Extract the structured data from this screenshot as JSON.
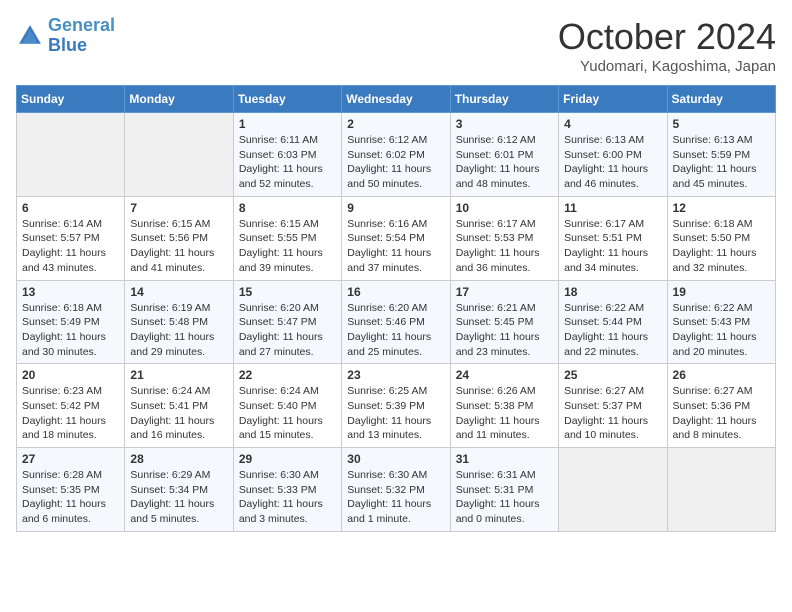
{
  "header": {
    "logo_line1": "General",
    "logo_line2": "Blue",
    "month": "October 2024",
    "location": "Yudomari, Kagoshima, Japan"
  },
  "columns": [
    "Sunday",
    "Monday",
    "Tuesday",
    "Wednesday",
    "Thursday",
    "Friday",
    "Saturday"
  ],
  "weeks": [
    [
      {
        "day": "",
        "info": ""
      },
      {
        "day": "",
        "info": ""
      },
      {
        "day": "1",
        "info": "Sunrise: 6:11 AM\nSunset: 6:03 PM\nDaylight: 11 hours and 52 minutes."
      },
      {
        "day": "2",
        "info": "Sunrise: 6:12 AM\nSunset: 6:02 PM\nDaylight: 11 hours and 50 minutes."
      },
      {
        "day": "3",
        "info": "Sunrise: 6:12 AM\nSunset: 6:01 PM\nDaylight: 11 hours and 48 minutes."
      },
      {
        "day": "4",
        "info": "Sunrise: 6:13 AM\nSunset: 6:00 PM\nDaylight: 11 hours and 46 minutes."
      },
      {
        "day": "5",
        "info": "Sunrise: 6:13 AM\nSunset: 5:59 PM\nDaylight: 11 hours and 45 minutes."
      }
    ],
    [
      {
        "day": "6",
        "info": "Sunrise: 6:14 AM\nSunset: 5:57 PM\nDaylight: 11 hours and 43 minutes."
      },
      {
        "day": "7",
        "info": "Sunrise: 6:15 AM\nSunset: 5:56 PM\nDaylight: 11 hours and 41 minutes."
      },
      {
        "day": "8",
        "info": "Sunrise: 6:15 AM\nSunset: 5:55 PM\nDaylight: 11 hours and 39 minutes."
      },
      {
        "day": "9",
        "info": "Sunrise: 6:16 AM\nSunset: 5:54 PM\nDaylight: 11 hours and 37 minutes."
      },
      {
        "day": "10",
        "info": "Sunrise: 6:17 AM\nSunset: 5:53 PM\nDaylight: 11 hours and 36 minutes."
      },
      {
        "day": "11",
        "info": "Sunrise: 6:17 AM\nSunset: 5:51 PM\nDaylight: 11 hours and 34 minutes."
      },
      {
        "day": "12",
        "info": "Sunrise: 6:18 AM\nSunset: 5:50 PM\nDaylight: 11 hours and 32 minutes."
      }
    ],
    [
      {
        "day": "13",
        "info": "Sunrise: 6:18 AM\nSunset: 5:49 PM\nDaylight: 11 hours and 30 minutes."
      },
      {
        "day": "14",
        "info": "Sunrise: 6:19 AM\nSunset: 5:48 PM\nDaylight: 11 hours and 29 minutes."
      },
      {
        "day": "15",
        "info": "Sunrise: 6:20 AM\nSunset: 5:47 PM\nDaylight: 11 hours and 27 minutes."
      },
      {
        "day": "16",
        "info": "Sunrise: 6:20 AM\nSunset: 5:46 PM\nDaylight: 11 hours and 25 minutes."
      },
      {
        "day": "17",
        "info": "Sunrise: 6:21 AM\nSunset: 5:45 PM\nDaylight: 11 hours and 23 minutes."
      },
      {
        "day": "18",
        "info": "Sunrise: 6:22 AM\nSunset: 5:44 PM\nDaylight: 11 hours and 22 minutes."
      },
      {
        "day": "19",
        "info": "Sunrise: 6:22 AM\nSunset: 5:43 PM\nDaylight: 11 hours and 20 minutes."
      }
    ],
    [
      {
        "day": "20",
        "info": "Sunrise: 6:23 AM\nSunset: 5:42 PM\nDaylight: 11 hours and 18 minutes."
      },
      {
        "day": "21",
        "info": "Sunrise: 6:24 AM\nSunset: 5:41 PM\nDaylight: 11 hours and 16 minutes."
      },
      {
        "day": "22",
        "info": "Sunrise: 6:24 AM\nSunset: 5:40 PM\nDaylight: 11 hours and 15 minutes."
      },
      {
        "day": "23",
        "info": "Sunrise: 6:25 AM\nSunset: 5:39 PM\nDaylight: 11 hours and 13 minutes."
      },
      {
        "day": "24",
        "info": "Sunrise: 6:26 AM\nSunset: 5:38 PM\nDaylight: 11 hours and 11 minutes."
      },
      {
        "day": "25",
        "info": "Sunrise: 6:27 AM\nSunset: 5:37 PM\nDaylight: 11 hours and 10 minutes."
      },
      {
        "day": "26",
        "info": "Sunrise: 6:27 AM\nSunset: 5:36 PM\nDaylight: 11 hours and 8 minutes."
      }
    ],
    [
      {
        "day": "27",
        "info": "Sunrise: 6:28 AM\nSunset: 5:35 PM\nDaylight: 11 hours and 6 minutes."
      },
      {
        "day": "28",
        "info": "Sunrise: 6:29 AM\nSunset: 5:34 PM\nDaylight: 11 hours and 5 minutes."
      },
      {
        "day": "29",
        "info": "Sunrise: 6:30 AM\nSunset: 5:33 PM\nDaylight: 11 hours and 3 minutes."
      },
      {
        "day": "30",
        "info": "Sunrise: 6:30 AM\nSunset: 5:32 PM\nDaylight: 11 hours and 1 minute."
      },
      {
        "day": "31",
        "info": "Sunrise: 6:31 AM\nSunset: 5:31 PM\nDaylight: 11 hours and 0 minutes."
      },
      {
        "day": "",
        "info": ""
      },
      {
        "day": "",
        "info": ""
      }
    ]
  ]
}
